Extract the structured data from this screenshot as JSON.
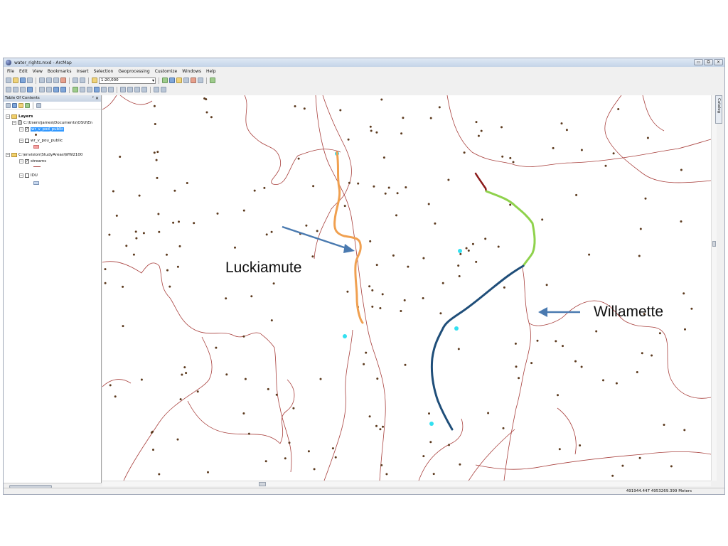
{
  "window": {
    "title": "water_rights.mxd - ArcMap",
    "controls": [
      "▭",
      "⧉",
      "✕"
    ]
  },
  "menu": [
    "File",
    "Edit",
    "View",
    "Bookmarks",
    "Insert",
    "Selection",
    "Geoprocessing",
    "Customize",
    "Windows",
    "Help"
  ],
  "toolbar": {
    "scale": "1:20,000"
  },
  "toc": {
    "header": "Table Of Contents",
    "pin": "ᵖ",
    "close": "✕",
    "layers_label": "Layers",
    "group1": "C:\\Users\\james\\Documents\\OSU\\En",
    "layer_pod": "wr_v_pod_public",
    "layer_pou": "wr_v_pou_public",
    "group2": "C:\\envision\\StudyAreas\\WW2100",
    "layer_streams": "streams",
    "layer_idu": "IDU"
  },
  "catalog_tab": "Catalog",
  "status": {
    "coords": "491944.447  4953269.399 Meters"
  },
  "annotations": {
    "luckiamute": "Luckiamute",
    "willamette": "Willamette"
  },
  "colors": {
    "river_luckiamute": "#f0a050",
    "river_willamette_upper": "#8fd24c",
    "river_willamette_lower": "#1f4e79",
    "river_willamette_top": "#8b1a1a",
    "streams": "#a8403d",
    "points": "#5c3a1e",
    "pod_cyan": "#33e0f0",
    "arrow": "#4a7ab0"
  }
}
